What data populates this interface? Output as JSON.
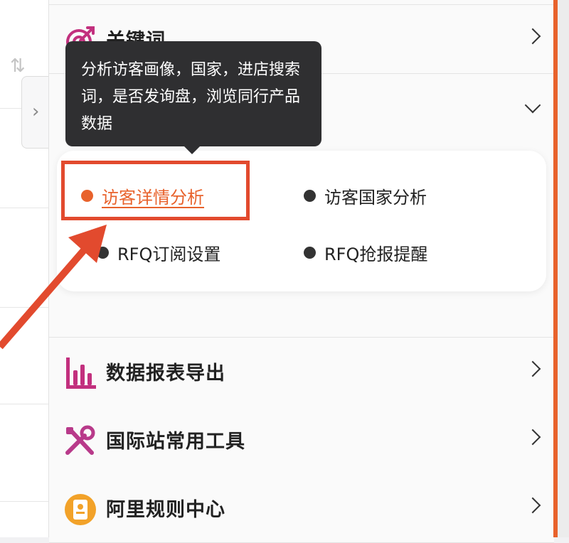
{
  "tooltip": {
    "text": "分析访客画像，国家，进店搜索词，是否发询盘，浏览同行产品数据"
  },
  "menu": {
    "keywords": {
      "label": "关键词"
    },
    "submenu": {
      "visitor_detail": "访客详情分析",
      "visitor_country": "访客国家分析",
      "rfq_subscribe": "RFQ订阅设置",
      "rfq_grab": "RFQ抢报提醒"
    },
    "items": [
      {
        "label": "数据报表导出",
        "icon": "bar-chart-icon"
      },
      {
        "label": "国际站常用工具",
        "icon": "tools-icon"
      },
      {
        "label": "阿里规则中心",
        "icon": "rules-icon"
      }
    ]
  },
  "colors": {
    "accent": "#e8622c",
    "highlight": "#e24a2e",
    "chart_icon": "#c2307e",
    "tools_icon": "#b83a8a",
    "rules_icon": "#f2a229"
  }
}
